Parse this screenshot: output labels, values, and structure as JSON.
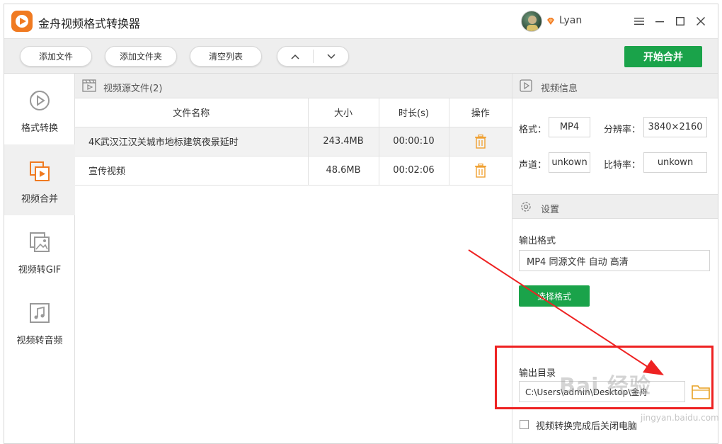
{
  "app": {
    "title": "金舟视频格式转换器",
    "user": "Lyan",
    "window_controls": [
      "menu-icon",
      "minimize-icon",
      "maximize-icon",
      "close-icon"
    ]
  },
  "toolbar": {
    "add_file": "添加文件",
    "add_folder": "添加文件夹",
    "clear_list": "清空列表",
    "move_up": "∧",
    "move_down": "∨",
    "start_merge": "开始合并"
  },
  "sidebar": {
    "items": [
      {
        "label": "格式转换",
        "icon": "format-convert-icon",
        "active": false
      },
      {
        "label": "视频合并",
        "icon": "video-merge-icon",
        "active": true
      },
      {
        "label": "视频转GIF",
        "icon": "gif-image-icon",
        "active": false
      },
      {
        "label": "视频转音频",
        "icon": "music-note-icon",
        "active": false
      }
    ]
  },
  "file_list": {
    "header": "视频源文件(2)",
    "columns": [
      "文件名称",
      "大小",
      "时长(s)",
      "操作"
    ],
    "rows": [
      {
        "name": "4K武汉江汉关城市地标建筑夜景延时",
        "size": "243.4MB",
        "duration": "00:00:10"
      },
      {
        "name": "宣传视频",
        "size": "48.6MB",
        "duration": "00:02:06"
      }
    ]
  },
  "video_info": {
    "header": "视频信息",
    "format_label": "格式：",
    "format_value": "MP4",
    "resolution_label": "分辨率：",
    "resolution_value": "3840×2160",
    "channel_label": "声道：",
    "channel_value": "unkown",
    "bitrate_label": "比特率：",
    "bitrate_value": "unkown"
  },
  "settings": {
    "header": "设置",
    "output_format_label": "输出格式",
    "output_format_value": "MP4 同源文件 自动 高清",
    "choose_format": "选择格式",
    "output_dir_label": "输出目录",
    "output_dir_value": "C:\\Users\\admin\\Desktop\\金舟",
    "shutdown_label": "视频转换完成后关闭电脑"
  },
  "watermark": {
    "text": "Bai 经验",
    "sub": "jingyan.baidu.com"
  },
  "colors": {
    "accent_green": "#1aa34a",
    "brand_orange": "#f07a21",
    "annotation_red": "#ee2222"
  }
}
